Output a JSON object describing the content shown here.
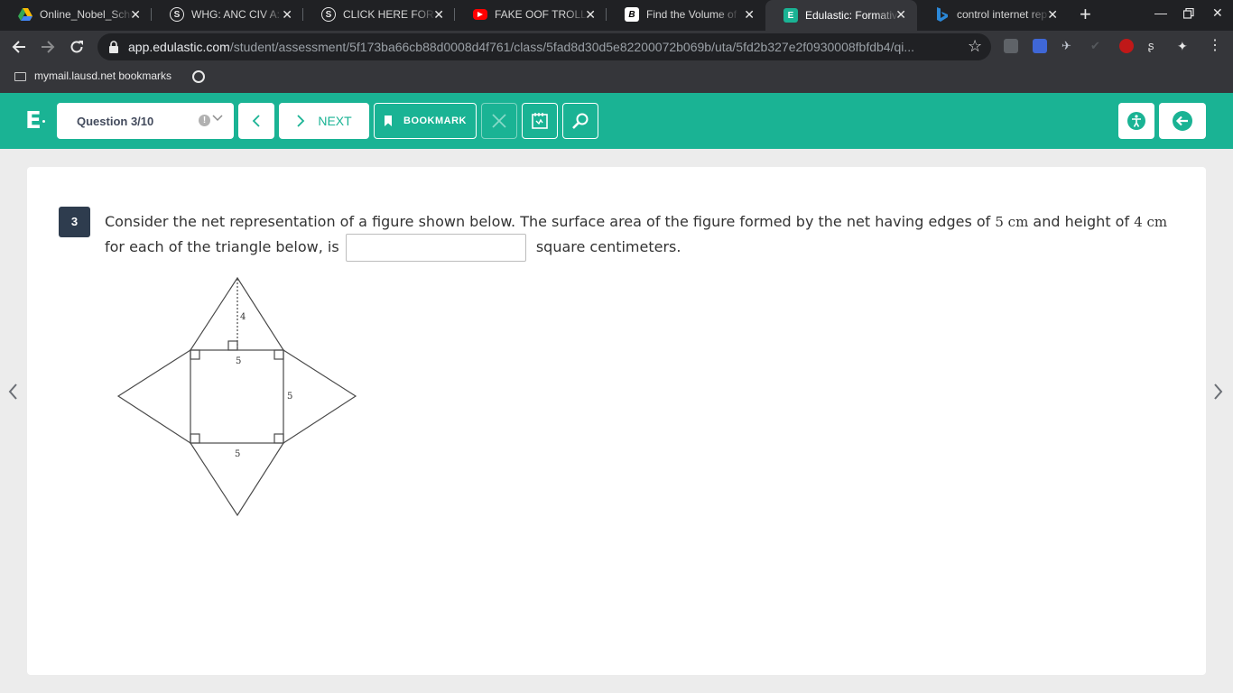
{
  "browser": {
    "tabs": [
      {
        "title": "Online_Nobel_Scho",
        "favicon": "google-drive-icon",
        "active": false
      },
      {
        "title": "WHG: ANC CIV A: T",
        "favicon": "schoology-icon",
        "active": false
      },
      {
        "title": "CLICK HERE FOR TI",
        "favicon": "schoology-icon",
        "active": false
      },
      {
        "title": "FAKE OOF TROLLIN",
        "favicon": "youtube-icon",
        "active": false
      },
      {
        "title": "Find the Volume of",
        "favicon": "brainly-icon",
        "active": false
      },
      {
        "title": "Edulastic: Formativ",
        "favicon": "edulastic-icon",
        "active": true
      },
      {
        "title": "control internet rep",
        "favicon": "bing-icon",
        "active": false
      }
    ],
    "url_host": "app.edulastic.com",
    "url_path": "/student/assessment/5f173ba66cb88d0008d4f761/class/5fad8d30d5e82200072b069b/uta/5fd2b327e2f0930008fbfdb4/qi...",
    "bookmark_label": "mymail.lausd.net bookmarks"
  },
  "header": {
    "logo": "E",
    "question_selector": "Question 3/10",
    "next_label": "NEXT",
    "bookmark_label": "BOOKMARK"
  },
  "question": {
    "number": "3",
    "text_part1": "Consider the net representation of a figure shown below. The surface area of the figure formed by the net having edges of ",
    "edge_value": "5 cm",
    "text_part2": " and height of ",
    "height_value": "4 cm",
    "text_part3": " for each of the triangle below, is ",
    "text_part4": " square centimeters.",
    "answer_value": "",
    "figure_labels": {
      "height": "4",
      "square_top": "5",
      "square_right": "5",
      "square_bottom": "5"
    }
  },
  "colors": {
    "brand": "#1ab394",
    "question_badge": "#2e3c4e",
    "chrome_dark": "#202124",
    "chrome_mid": "#35363a"
  }
}
